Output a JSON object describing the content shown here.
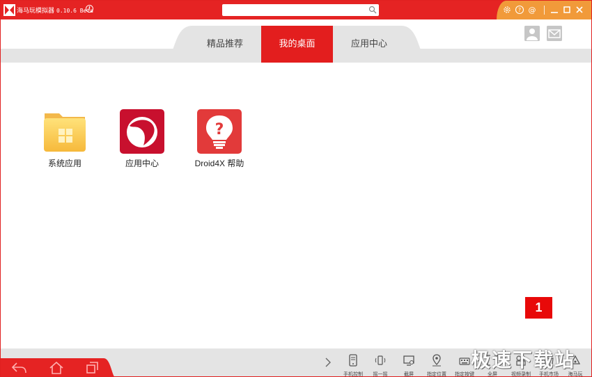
{
  "window": {
    "title": "海马玩模拟器",
    "version": "0.10.6 Beta",
    "info_glyph": "!"
  },
  "search": {
    "value": "",
    "placeholder": ""
  },
  "title_controls": [
    "settings-icon",
    "help-icon",
    "contact-icon",
    "minimize-icon",
    "maximize-icon",
    "close-icon"
  ],
  "tabs": [
    {
      "label": "精品推荐",
      "active": false
    },
    {
      "label": "我的桌面",
      "active": true
    },
    {
      "label": "应用中心",
      "active": false
    }
  ],
  "desktop": {
    "apps": [
      {
        "label": "系统应用",
        "icon": "folder-icon"
      },
      {
        "label": "应用中心",
        "icon": "app-center-icon"
      },
      {
        "label": "Droid4X 帮助",
        "icon": "help-bulb-icon"
      }
    ],
    "page_number": "1"
  },
  "toolbar": {
    "tools": [
      {
        "label": "手机控制",
        "icon": "phone-icon"
      },
      {
        "label": "摇一摇",
        "icon": "shake-icon"
      },
      {
        "label": "截屏",
        "icon": "screenshot-icon"
      },
      {
        "label": "指定位置",
        "icon": "location-icon"
      },
      {
        "label": "指定按键",
        "icon": "keyboard-icon"
      },
      {
        "label": "全屏",
        "icon": "fullscreen-icon"
      },
      {
        "label": "视频录制",
        "icon": "record-icon"
      },
      {
        "label": "手机市场",
        "icon": "market-icon"
      },
      {
        "label": "海马玩",
        "icon": "haima-icon"
      }
    ]
  },
  "watermark": "极速下载站",
  "colors": {
    "brand_red": "#e52323",
    "accent_orange": "#f19a3a",
    "bar_gray": "#e4e4e4"
  }
}
